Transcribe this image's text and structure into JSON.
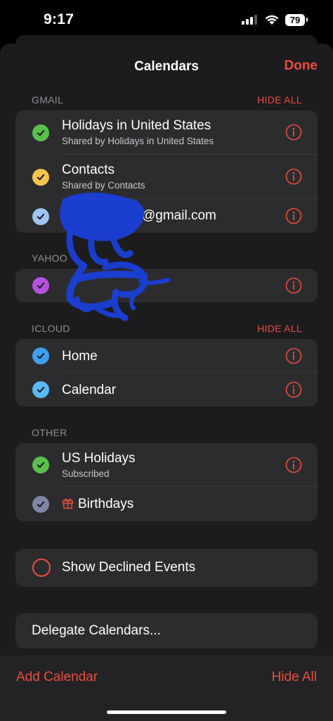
{
  "status": {
    "time": "9:17",
    "battery": "79"
  },
  "nav": {
    "title": "Calendars",
    "done": "Done"
  },
  "sections": {
    "gmail": {
      "header": "GMAIL",
      "hide_all": "HIDE ALL",
      "rows": [
        {
          "title": "Holidays in United States",
          "subtitle": "Shared by Holidays in United States",
          "color": "#5ac04b"
        },
        {
          "title": "Contacts",
          "subtitle": "Shared by Contacts",
          "color": "#f4c44f"
        },
        {
          "title": "@gmail.com",
          "color": "#9ec4f0"
        }
      ]
    },
    "yahoo": {
      "header": "YAHOO",
      "rows": [
        {
          "color": "#b352dc"
        }
      ]
    },
    "icloud": {
      "header": "ICLOUD",
      "hide_all": "HIDE ALL",
      "rows": [
        {
          "title": "Home",
          "color": "#3e9ff0"
        },
        {
          "title": "Calendar",
          "color": "#5ab9f5"
        }
      ]
    },
    "other": {
      "header": "OTHER",
      "rows": [
        {
          "title": "US Holidays",
          "subtitle": "Subscribed",
          "color": "#5ac04b"
        },
        {
          "title": "Birthdays",
          "color": "#7d87a3"
        }
      ]
    }
  },
  "declined": {
    "label": "Show Declined Events"
  },
  "delegate": {
    "label": "Delegate Calendars..."
  },
  "bottom": {
    "add_calendar": "Add Calendar",
    "hide_all": "Hide All"
  },
  "colors": {
    "accent": "#eb4d3d",
    "cell": "#2c2c2e",
    "sheet": "#1c1c1e",
    "redaction": "#1a3fd8"
  }
}
